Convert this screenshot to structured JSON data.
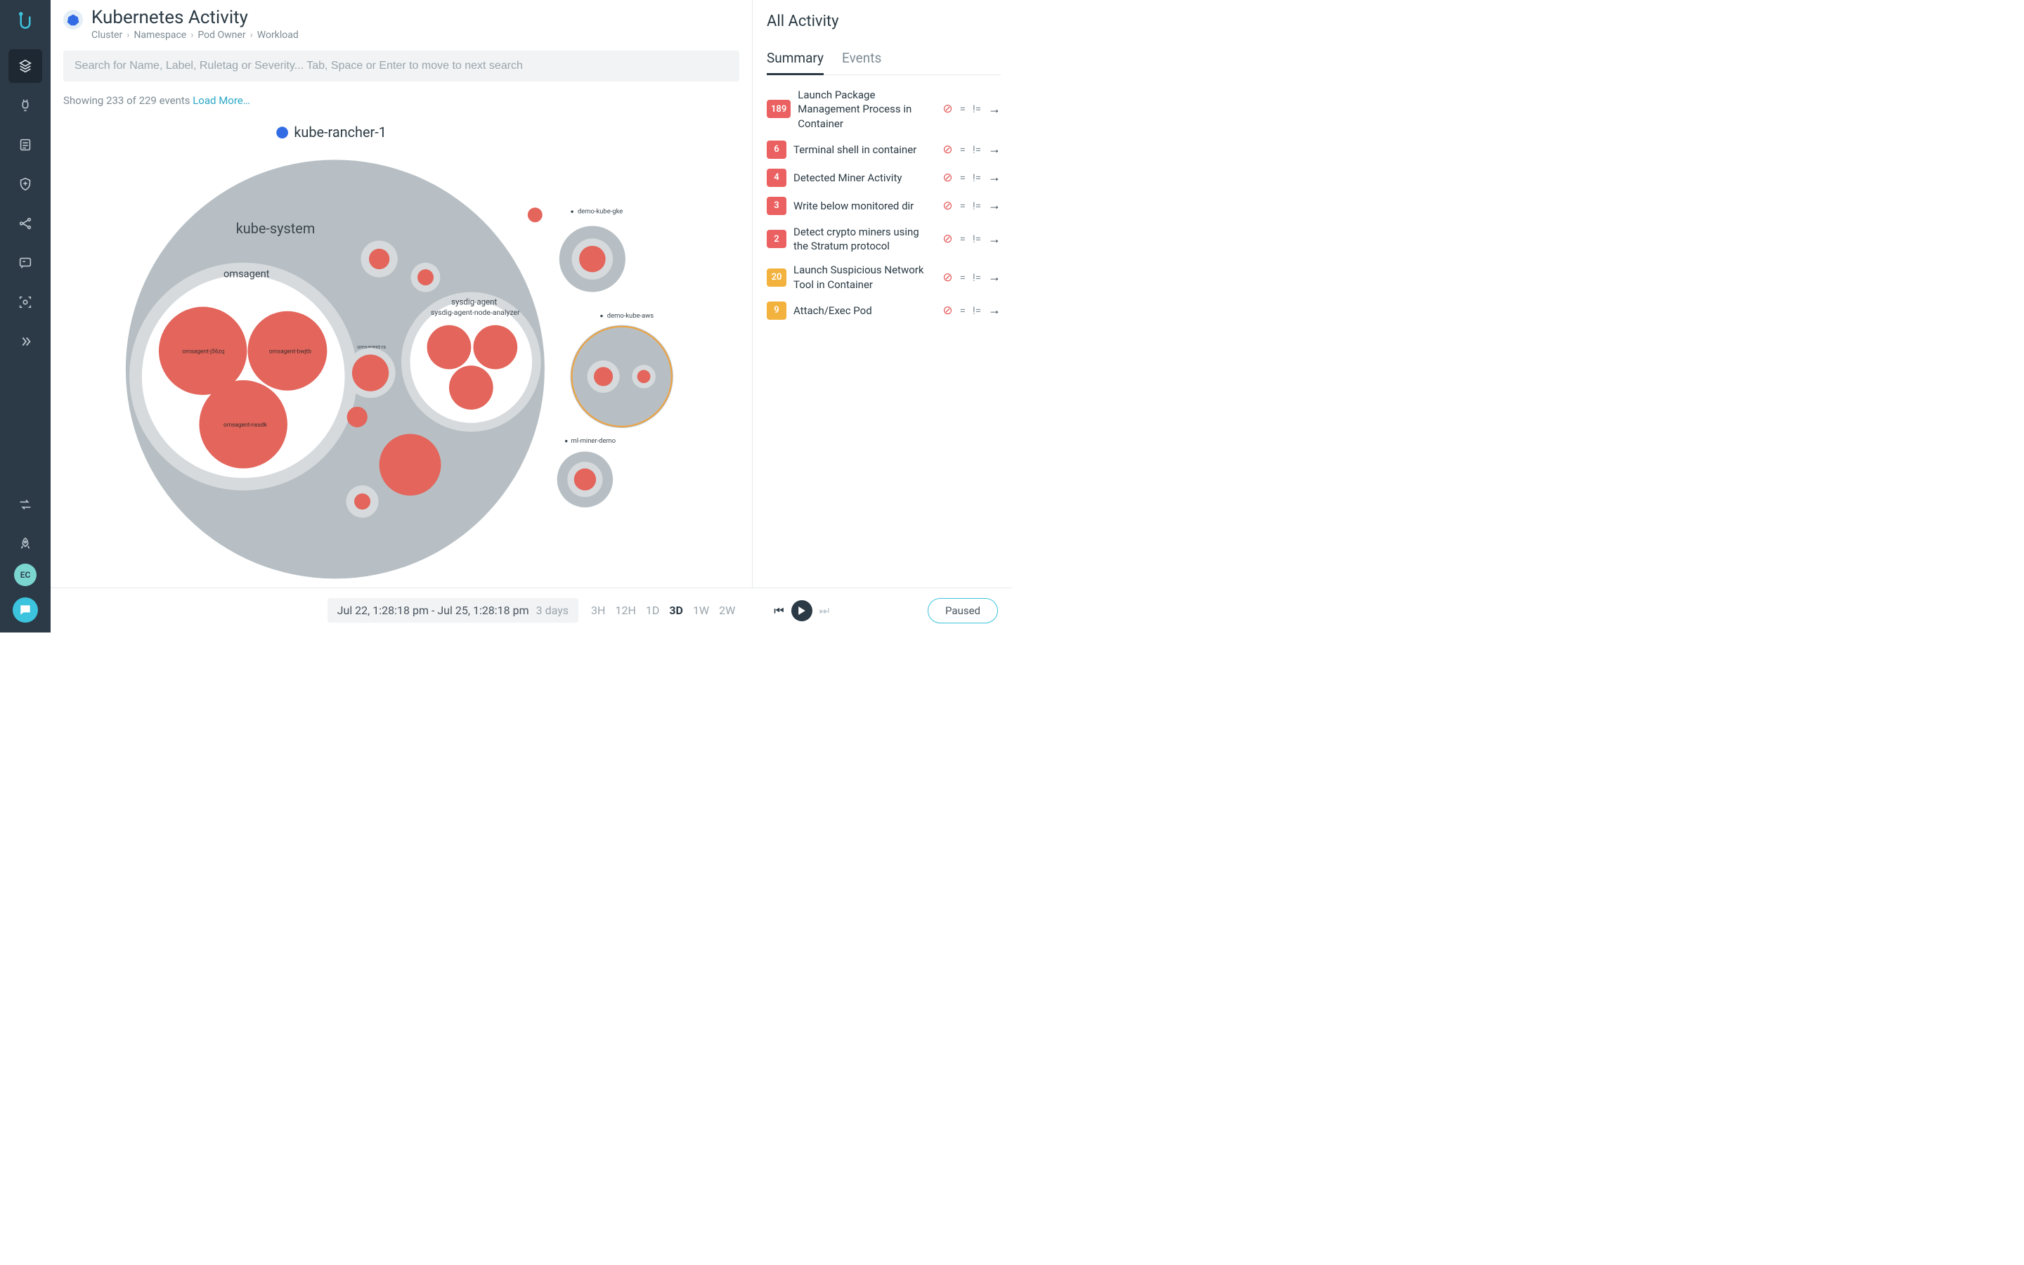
{
  "page": {
    "title": "Kubernetes Activity",
    "breadcrumbs": [
      "Cluster",
      "Namespace",
      "Pod Owner",
      "Workload"
    ]
  },
  "search": {
    "placeholder": "Search for Name, Label, Ruletag or Severity... Tab, Space or Enter to move to next search"
  },
  "results": {
    "text": "Showing 233 of 229 events ",
    "load_more": "Load More…"
  },
  "avatar": {
    "initials": "EC"
  },
  "panel": {
    "title": "All Activity",
    "tabs": [
      "Summary",
      "Events"
    ],
    "active_tab": 0,
    "items": [
      {
        "count": "189",
        "severity": "red",
        "label": "Launch Package Management Process in Container"
      },
      {
        "count": "6",
        "severity": "red",
        "label": "Terminal shell in container"
      },
      {
        "count": "4",
        "severity": "red",
        "label": "Detected Miner Activity"
      },
      {
        "count": "3",
        "severity": "red",
        "label": "Write below monitored dir"
      },
      {
        "count": "2",
        "severity": "red",
        "label": "Detect crypto miners using the Stratum protocol"
      },
      {
        "count": "20",
        "severity": "orange",
        "label": "Launch Suspicious Network Tool in Container"
      },
      {
        "count": "9",
        "severity": "orange",
        "label": "Attach/Exec Pod"
      }
    ]
  },
  "timeline": {
    "range_text": "Jul 22, 1:28:18 pm - Jul 25, 1:28:18 pm",
    "duration": "3 days",
    "options": [
      "3H",
      "12H",
      "1D",
      "3D",
      "1W",
      "2W"
    ],
    "active_option": "3D",
    "state": "Paused"
  },
  "viz": {
    "root_label": "kube-rancher-1",
    "groups": {
      "kube_system": "kube-system",
      "omsagent": "omsagent",
      "sysdig1": "sysdig-agent",
      "sysdig2": "sysdig-agent-node-analyzer",
      "omsagent_rs": "omsagent-rs",
      "demo_gke": "demo-kube-gke",
      "demo_aws": "demo-kube-aws",
      "miner": "ml-miner-demo",
      "pods": {
        "a": "omsagent-j56zq",
        "b": "omsagent-bwjtb",
        "c": "omsagent-nssdk"
      }
    }
  },
  "colors": {
    "accent": "#3cc3dd",
    "cluster_fill": "#b7bfc4",
    "node_fill": "#e3655b",
    "highlight_ring": "#f0a33e"
  }
}
